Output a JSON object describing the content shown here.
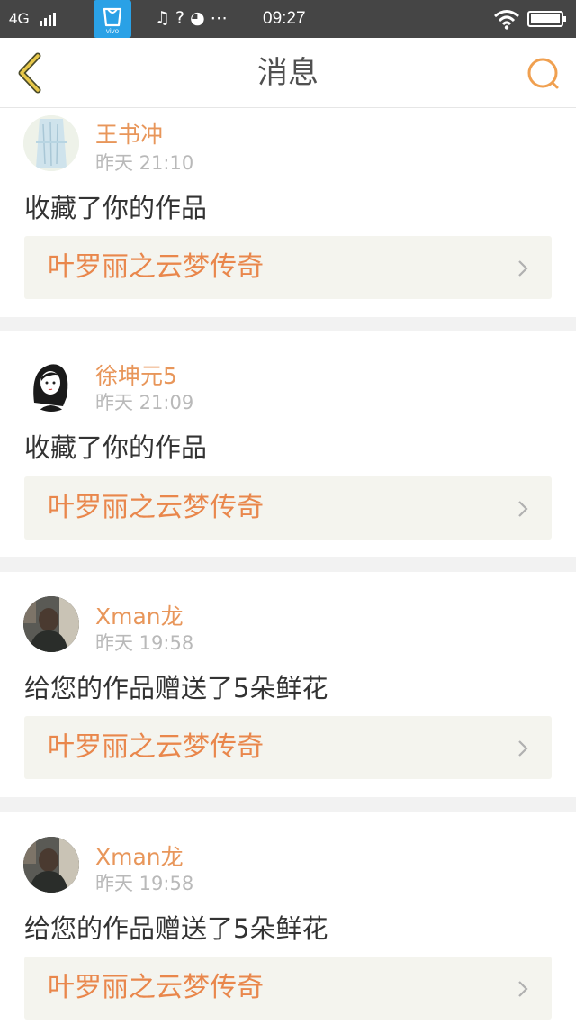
{
  "status_bar": {
    "network": "4G",
    "vivo_label": "vivo",
    "icons": [
      "music-note-icon",
      "question-icon",
      "palette-icon",
      "more-dots-icon"
    ],
    "time": "09:27",
    "battery_level": 1.0
  },
  "navbar": {
    "title": "消息",
    "back_icon": "chevron-left-icon",
    "search_icon": "search-icon",
    "accent_color": "#f0a050"
  },
  "messages": [
    {
      "user": "王书冲",
      "time": "昨天 21:10",
      "action": "收藏了你的作品",
      "work": "叶罗丽之云梦传奇",
      "avatar": "avatar-illustration"
    },
    {
      "user": "徐坤元5",
      "time": "昨天 21:09",
      "action": "收藏了你的作品",
      "work": "叶罗丽之云梦传奇",
      "avatar": "avatar-girl-drawing"
    },
    {
      "user": "Xman龙",
      "time": "昨天 19:58",
      "action": "给您的作品赠送了5朵鲜花",
      "work": "叶罗丽之云梦传奇",
      "avatar": "avatar-photo"
    },
    {
      "user": "Xman龙",
      "time": "昨天 19:58",
      "action": "给您的作品赠送了5朵鲜花",
      "work": "叶罗丽之云梦传奇",
      "avatar": "avatar-photo"
    }
  ],
  "colors": {
    "username": "#e8965a",
    "work_title": "#e9874c",
    "timestamp": "#b9b9b9",
    "work_bg": "#f4f4ee",
    "status_bar": "#454545"
  }
}
